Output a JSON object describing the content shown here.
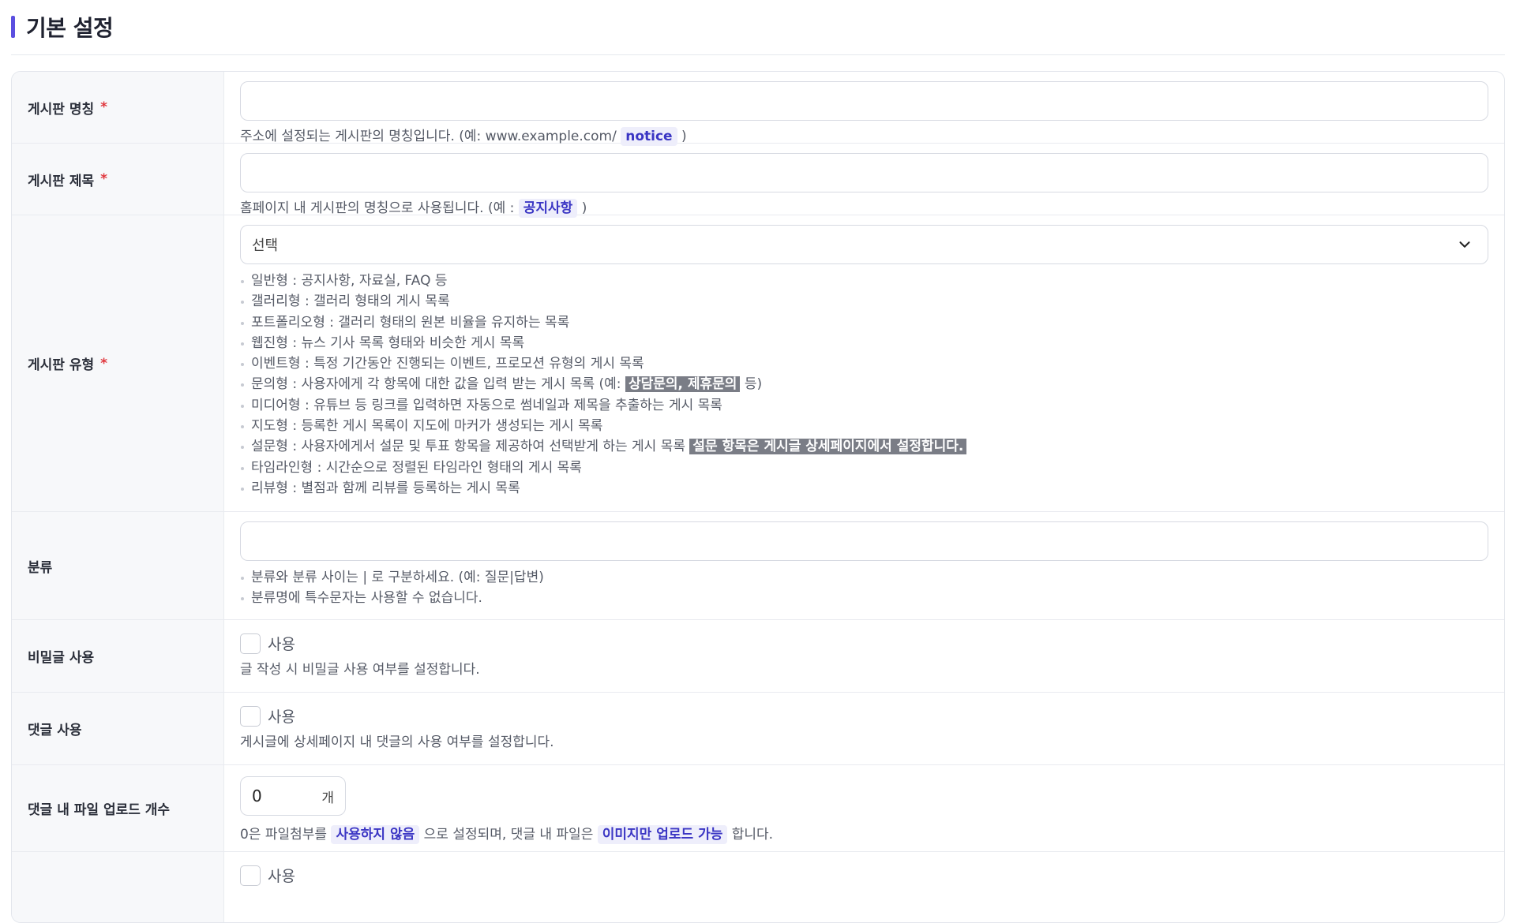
{
  "header": {
    "title": "기본 설정"
  },
  "accent_color": "#5b4fe0",
  "form": {
    "board_name": {
      "label": "게시판 명칭",
      "required_mark": "*",
      "value": "",
      "help_prefix": "주소에 설정되는 게시판의 명칭입니다. (예: www.example.com/",
      "help_tag": "notice",
      "help_suffix": ")"
    },
    "board_title": {
      "label": "게시판 제목",
      "required_mark": "*",
      "value": "",
      "help_prefix": "홈페이지 내 게시판의 명칭으로 사용됩니다. (예 :",
      "help_tag": "공지사항",
      "help_suffix": ")"
    },
    "board_type": {
      "label": "게시판 유형",
      "required_mark": "*",
      "selected": "선택",
      "types": [
        "일반형 : 공지사항, 자료실, FAQ 등",
        "갤러리형 : 갤러리 형태의 게시 목록",
        "포트폴리오형 : 갤러리 형태의 원본 비율을 유지하는 목록",
        "웹진형 : 뉴스 기사 목록 형태와 비슷한 게시 목록",
        "이벤트형 : 특정 기간동안 진행되는 이벤트, 프로모션 유형의 게시 목록"
      ],
      "inquiry_prefix": "문의형 : 사용자에게 각 항목에 대한 값을 입력 받는 게시 목록 (예:",
      "inquiry_highlight": "상담문의, 제휴문의",
      "inquiry_suffix": "등)",
      "media": "미디어형 : 유튜브 등 링크를 입력하면 자동으로 썸네일과 제목을 추출하는 게시 목록",
      "map": "지도형 : 등록한 게시 목록이 지도에 마커가 생성되는 게시 목록",
      "survey_prefix": "설문형 : 사용자에게서 설문 및 투표 항목을 제공하여 선택받게 하는 게시 목록",
      "survey_highlight": "설문 항목은 게시글 상세페이지에서 설정합니다.",
      "timeline": "타임라인형 : 시간순으로 정렬된 타임라인 형태의 게시 목록",
      "review": "리뷰형 : 별점과 함께 리뷰를 등록하는 게시 목록"
    },
    "category": {
      "label": "분류",
      "value": "",
      "help": [
        "분류와 분류 사이는 | 로 구분하세요. (예: 질문|답변)",
        "분류명에 특수문자는 사용할 수 없습니다."
      ]
    },
    "secret_post": {
      "label": "비밀글 사용",
      "checkbox_label": "사용",
      "checked": false,
      "help": "글 작성 시 비밀글 사용 여부를 설정합니다."
    },
    "comments": {
      "label": "댓글 사용",
      "checkbox_label": "사용",
      "checked": false,
      "help": "게시글에 상세페이지 내 댓글의 사용 여부를 설정합니다."
    },
    "comment_uploads": {
      "label": "댓글 내 파일 업로드 개수",
      "value": "0",
      "unit": "개",
      "help_prefix": "0은 파일첨부를",
      "help_tag1": "사용하지 않음",
      "help_mid": "으로 설정되며, 댓글 내 파일은",
      "help_tag2": "이미지만 업로드 가능",
      "help_suffix": "합니다."
    },
    "next_row": {
      "checkbox_label": "사용"
    }
  }
}
